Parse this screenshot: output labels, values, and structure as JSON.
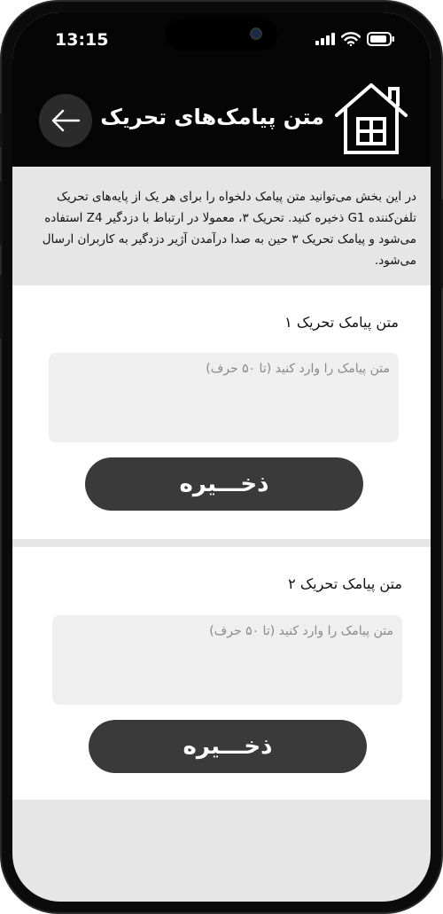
{
  "status_bar": {
    "time": "13:15",
    "icons": [
      "signal-icon",
      "wifi-icon",
      "battery-icon"
    ]
  },
  "header": {
    "title": "متن پیامک‌های تحریک",
    "back_icon": "arrow-left-icon",
    "logo_icon": "house-icon"
  },
  "intro": {
    "text": "در این بخش می‌توانید متن پیامک دلخواه را برای هر یک از پایه‌های تحریک تلفن‌کننده G1 ذخیره کنید. تحریک ۳، معمولا در ارتباط با دزدگیر Z4 استفاده می‌شود و پیامک تحریک ۳ حین به صدا درآمدن آژیر دزدگیر به کاربران ارسال می‌شود."
  },
  "triggers": [
    {
      "label": "متن پیامک تحریک ۱",
      "placeholder": "متن پیامک را وارد کنید (تا ۵۰ حرف)",
      "value": "",
      "save_label": "ذخـــیره"
    },
    {
      "label": "متن پیامک تحریک ۲",
      "placeholder": "متن پیامک را وارد کنید (تا ۵۰ حرف)",
      "value": "",
      "save_label": "ذخـــیره"
    }
  ],
  "colors": {
    "header_bg": "#050505",
    "page_bg": "#e6e6e6",
    "card_bg": "#ffffff",
    "input_bg": "#efefef",
    "button_bg": "#3a3a3a"
  }
}
